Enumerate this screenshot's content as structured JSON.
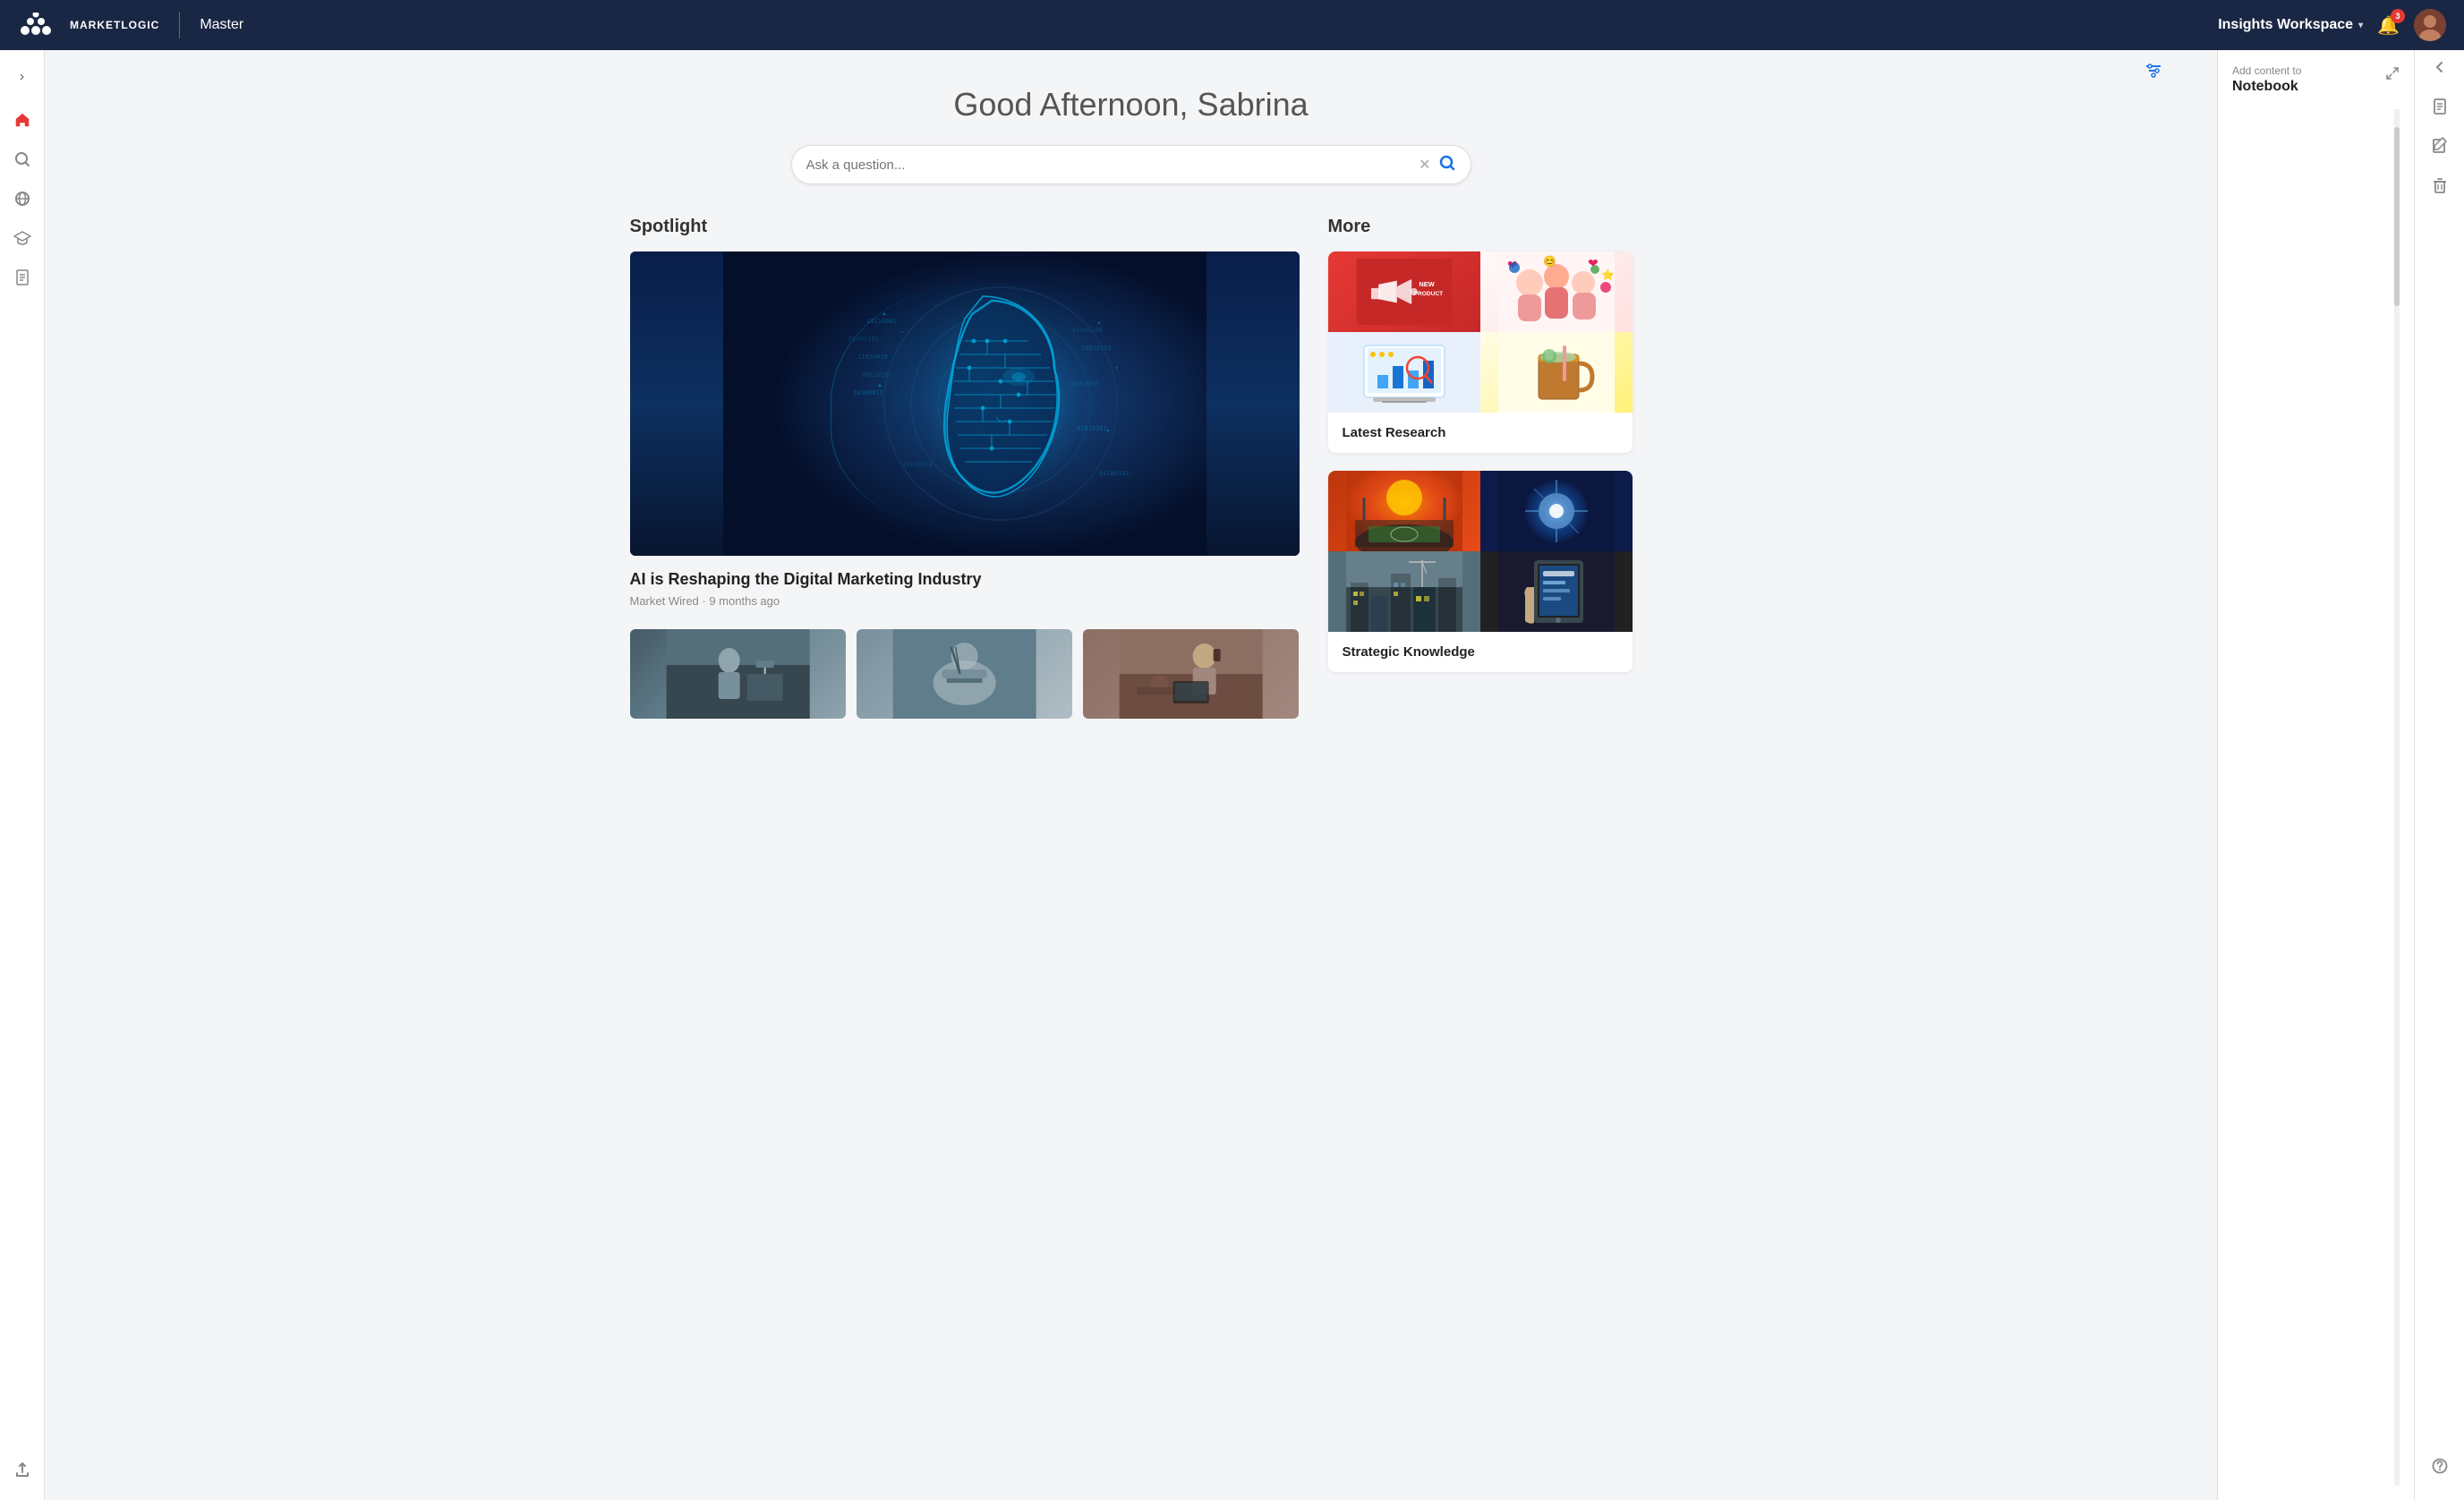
{
  "app": {
    "logo_text": "MARKETLOGIC",
    "app_name": "Master"
  },
  "top_nav": {
    "workspace_label": "Insights Workspace",
    "workspace_chevron": "▾",
    "notification_count": "3",
    "collapse_label": "‹"
  },
  "sidebar": {
    "expand_icon": "›",
    "items": [
      {
        "id": "home",
        "icon": "🏠",
        "label": "Home",
        "active": true
      },
      {
        "id": "search",
        "icon": "🔍",
        "label": "Search"
      },
      {
        "id": "globe",
        "icon": "🌐",
        "label": "Discover"
      },
      {
        "id": "learn",
        "icon": "🎓",
        "label": "Learn"
      },
      {
        "id": "reports",
        "icon": "📋",
        "label": "Reports"
      },
      {
        "id": "upload",
        "icon": "⬆",
        "label": "Upload"
      }
    ]
  },
  "greeting": "Good Afternoon, Sabrina",
  "search": {
    "placeholder": "Ask a question...",
    "value": ""
  },
  "spotlight": {
    "section_title": "Spotlight",
    "article_title": "AI is Reshaping the Digital Marketing Industry",
    "article_meta": "Market Wired · 9 months ago"
  },
  "thumbnails": [
    {
      "id": "thumb1",
      "alt": "Laboratory research"
    },
    {
      "id": "thumb2",
      "alt": "Scientific tools"
    },
    {
      "id": "thumb3",
      "alt": "Office work"
    }
  ],
  "more": {
    "section_title": "More",
    "collections": [
      {
        "id": "latest-research",
        "name": "Latest Research",
        "cells": [
          "new-product",
          "social",
          "analytics",
          "cocktail"
        ]
      },
      {
        "id": "strategic-knowledge",
        "name": "Strategic Knowledge",
        "cells": [
          "stadium",
          "blue-burst",
          "city",
          "tablet"
        ]
      }
    ]
  },
  "notebook_panel": {
    "add_text": "Add content to",
    "title": "Notebook",
    "expand_icon": "⤢"
  },
  "right_panel_icons": [
    {
      "id": "collapse",
      "icon": "›",
      "label": "collapse-panel"
    },
    {
      "id": "document",
      "icon": "📄",
      "label": "document-icon"
    },
    {
      "id": "edit",
      "icon": "📝",
      "label": "edit-icon"
    },
    {
      "id": "trash",
      "icon": "🗑",
      "label": "trash-icon"
    },
    {
      "id": "help",
      "icon": "❓",
      "label": "help-icon"
    }
  ],
  "filter_icon": "⊞"
}
